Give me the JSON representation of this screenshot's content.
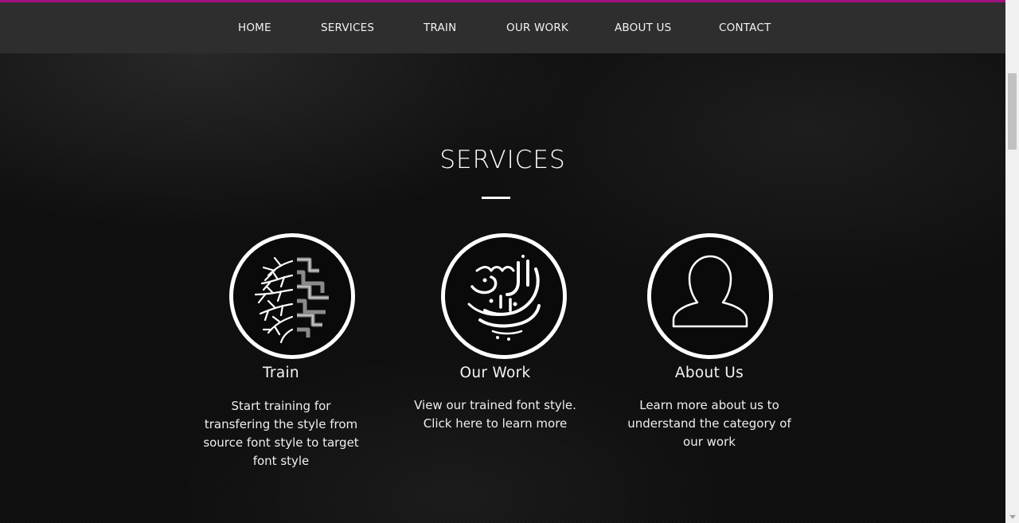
{
  "nav": {
    "accent_color": "#a0127f",
    "items": [
      "HOME",
      "SERVICES",
      "TRAIN",
      "OUR WORK",
      "ABOUT US",
      "CONTACT"
    ]
  },
  "services": {
    "title": "SERVICES",
    "cards": [
      {
        "icon": "brain-circuit-icon",
        "title": "Train",
        "description": [
          "Start training for",
          "transfering the style from",
          "source font style to target",
          "font style"
        ]
      },
      {
        "icon": "calligraphy-icon",
        "title": "Our Work",
        "description": [
          "View our trained font style.",
          "Click here to learn more"
        ]
      },
      {
        "icon": "user-silhouette-icon",
        "title": "About Us",
        "description": [
          "Learn more about us to",
          "understand the category of",
          "our work"
        ]
      }
    ]
  }
}
